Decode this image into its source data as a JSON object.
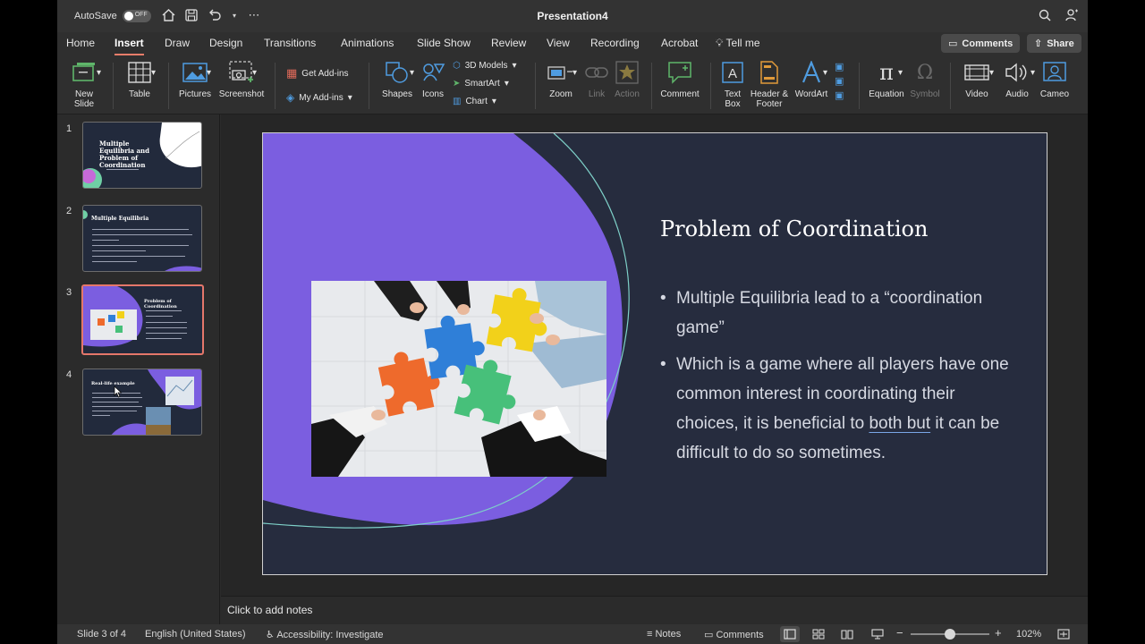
{
  "titlebar": {
    "autosave_label": "AutoSave",
    "autosave_state": "OFF",
    "document_title": "Presentation4"
  },
  "menu": {
    "tabs": [
      "Home",
      "Insert",
      "Draw",
      "Design",
      "Transitions",
      "Animations",
      "Slide Show",
      "Review",
      "View",
      "Recording",
      "Acrobat",
      "Tell me"
    ],
    "active_tab": "Insert",
    "comments_label": "Comments",
    "share_label": "Share"
  },
  "ribbon": {
    "new_slide": "New Slide",
    "table": "Table",
    "pictures": "Pictures",
    "screenshot": "Screenshot",
    "get_addins": "Get Add-ins",
    "my_addins": "My Add-ins",
    "shapes": "Shapes",
    "icons": "Icons",
    "models_3d": "3D Models",
    "smartart": "SmartArt",
    "chart": "Chart",
    "zoom": "Zoom",
    "link": "Link",
    "action": "Action",
    "comment": "Comment",
    "text_box": "Text Box",
    "header_footer": "Header & Footer",
    "wordart": "WordArt",
    "equation": "Equation",
    "symbol": "Symbol",
    "video": "Video",
    "audio": "Audio",
    "cameo": "Cameo"
  },
  "thumbnails": [
    {
      "number": "1",
      "title": "Multiple Equilibria and Problem of Coordination"
    },
    {
      "number": "2",
      "title": "Multiple Equilibria"
    },
    {
      "number": "3",
      "title": "Problem of Coordination"
    },
    {
      "number": "4",
      "title": "Real-life example"
    }
  ],
  "slide": {
    "title": "Problem of Coordination",
    "bullet1": "Multiple Equilibria lead to a “coordination game”",
    "bullet2_before": "Which is a game where all players have one common interest in coordinating their choices, it is beneficial to ",
    "bullet2_underlined": "both but",
    "bullet2_after": " it can be difficult to do so sometimes."
  },
  "notes_placeholder": "Click to add notes",
  "status": {
    "slide_info": "Slide 3 of 4",
    "language": "English (United States)",
    "accessibility": "Accessibility: Investigate",
    "notes": "Notes",
    "comments": "Comments",
    "zoom": "102%"
  },
  "colors": {
    "accent": "#e5776a",
    "slide_bg": "#262c3e",
    "slide_purple": "#7b5ee0"
  }
}
